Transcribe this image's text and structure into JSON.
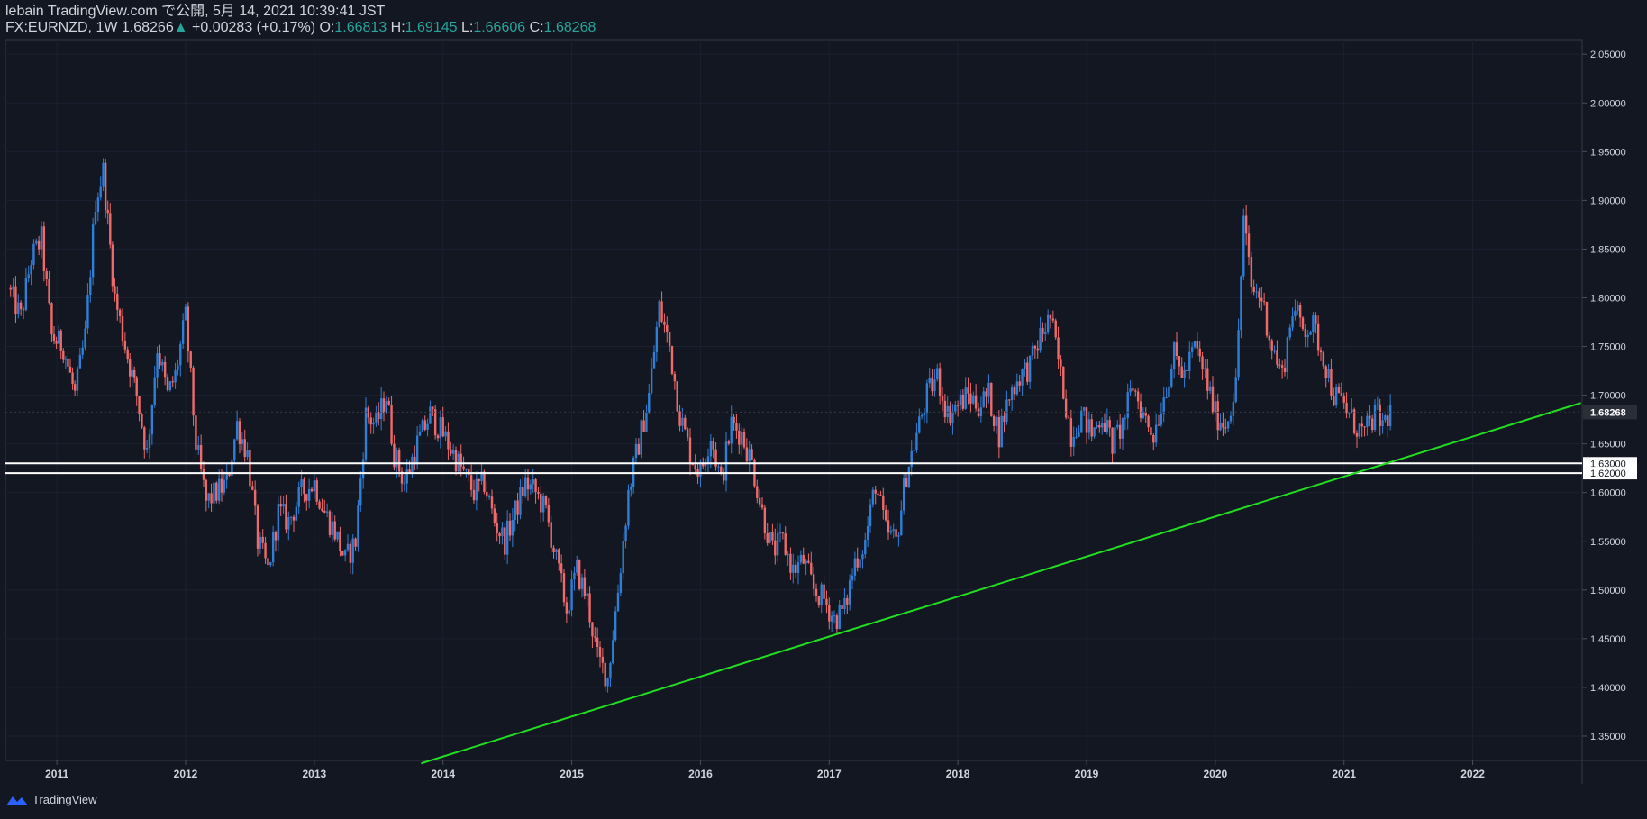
{
  "header": {
    "publish_line": "lebain TradingView.com で公開, 5月 14, 2021 10:39:41 JST",
    "symbol": "FX:EURNZD, 1W 1.68266",
    "change_arrow": "▲",
    "change": "+0.00283 (+0.17%)",
    "o_label": "O:",
    "o_value": "1.66813",
    "h_label": "H:",
    "h_value": "1.69145",
    "l_label": "L:",
    "l_value": "1.66606",
    "c_label": "C:",
    "c_value": "1.68268"
  },
  "footer": {
    "brand": "TradingView"
  },
  "colors": {
    "background": "#131722",
    "up_candle": "#2f7fd6",
    "down_candle": "#ef6b6b",
    "trendline": "#22dd22",
    "hline": "#ffffff",
    "price_label_bg": "#2a2e39"
  },
  "chart_data": {
    "type": "candlestick",
    "symbol": "FX:EURNZD",
    "interval": "1W",
    "x_ticks": [
      "2011",
      "2012",
      "2013",
      "2014",
      "2015",
      "2016",
      "2017",
      "2018",
      "2019",
      "2020",
      "2021",
      "2022"
    ],
    "y_ticks": [
      "1.35000",
      "1.40000",
      "1.45000",
      "1.50000",
      "1.55000",
      "1.60000",
      "1.65000",
      "1.70000",
      "1.75000",
      "1.80000",
      "1.85000",
      "1.90000",
      "1.95000",
      "2.00000",
      "2.05000"
    ],
    "ylim": [
      1.325,
      2.065
    ],
    "xlim": [
      2010.6,
      2022.85
    ],
    "last_price": "1.68268",
    "horizontal_levels": [
      {
        "label": "1.63000",
        "value": 1.63
      },
      {
        "label": "1.62000",
        "value": 1.62
      }
    ],
    "trendline": {
      "start": {
        "x": 2013.83,
        "y": 1.322
      },
      "end": {
        "x": 2022.84,
        "y": 1.692
      }
    },
    "close_path": [
      [
        2010.62,
        1.81
      ],
      [
        2010.72,
        1.78
      ],
      [
        2010.8,
        1.84
      ],
      [
        2010.88,
        1.86
      ],
      [
        2010.96,
        1.76
      ],
      [
        2011.05,
        1.75
      ],
      [
        2011.14,
        1.7
      ],
      [
        2011.22,
        1.76
      ],
      [
        2011.3,
        1.9
      ],
      [
        2011.36,
        1.93
      ],
      [
        2011.45,
        1.8
      ],
      [
        2011.55,
        1.74
      ],
      [
        2011.62,
        1.7
      ],
      [
        2011.7,
        1.64
      ],
      [
        2011.78,
        1.75
      ],
      [
        2011.86,
        1.7
      ],
      [
        2011.92,
        1.72
      ],
      [
        2012.0,
        1.78
      ],
      [
        2012.08,
        1.65
      ],
      [
        2012.16,
        1.59
      ],
      [
        2012.24,
        1.6
      ],
      [
        2012.32,
        1.61
      ],
      [
        2012.4,
        1.67
      ],
      [
        2012.48,
        1.64
      ],
      [
        2012.56,
        1.55
      ],
      [
        2012.64,
        1.52
      ],
      [
        2012.72,
        1.58
      ],
      [
        2012.8,
        1.57
      ],
      [
        2012.9,
        1.6
      ],
      [
        2013.0,
        1.61
      ],
      [
        2013.08,
        1.58
      ],
      [
        2013.16,
        1.56
      ],
      [
        2013.24,
        1.53
      ],
      [
        2013.32,
        1.55
      ],
      [
        2013.4,
        1.68
      ],
      [
        2013.48,
        1.67
      ],
      [
        2013.56,
        1.7
      ],
      [
        2013.62,
        1.64
      ],
      [
        2013.7,
        1.61
      ],
      [
        2013.8,
        1.65
      ],
      [
        2013.9,
        1.68
      ],
      [
        2014.0,
        1.66
      ],
      [
        2014.08,
        1.64
      ],
      [
        2014.16,
        1.62
      ],
      [
        2014.24,
        1.6
      ],
      [
        2014.32,
        1.61
      ],
      [
        2014.4,
        1.57
      ],
      [
        2014.48,
        1.55
      ],
      [
        2014.56,
        1.58
      ],
      [
        2014.64,
        1.61
      ],
      [
        2014.72,
        1.6
      ],
      [
        2014.8,
        1.58
      ],
      [
        2014.88,
        1.53
      ],
      [
        2014.96,
        1.48
      ],
      [
        2015.04,
        1.52
      ],
      [
        2015.12,
        1.49
      ],
      [
        2015.2,
        1.43
      ],
      [
        2015.28,
        1.41
      ],
      [
        2015.36,
        1.5
      ],
      [
        2015.44,
        1.6
      ],
      [
        2015.52,
        1.65
      ],
      [
        2015.6,
        1.7
      ],
      [
        2015.68,
        1.79
      ],
      [
        2015.76,
        1.75
      ],
      [
        2015.84,
        1.68
      ],
      [
        2015.92,
        1.64
      ],
      [
        2016.0,
        1.62
      ],
      [
        2016.08,
        1.66
      ],
      [
        2016.16,
        1.61
      ],
      [
        2016.24,
        1.67
      ],
      [
        2016.32,
        1.66
      ],
      [
        2016.4,
        1.63
      ],
      [
        2016.48,
        1.58
      ],
      [
        2016.56,
        1.54
      ],
      [
        2016.64,
        1.55
      ],
      [
        2016.72,
        1.52
      ],
      [
        2016.8,
        1.53
      ],
      [
        2016.88,
        1.5
      ],
      [
        2016.96,
        1.49
      ],
      [
        2017.04,
        1.47
      ],
      [
        2017.12,
        1.48
      ],
      [
        2017.2,
        1.53
      ],
      [
        2017.28,
        1.55
      ],
      [
        2017.36,
        1.61
      ],
      [
        2017.44,
        1.56
      ],
      [
        2017.52,
        1.55
      ],
      [
        2017.6,
        1.62
      ],
      [
        2017.68,
        1.66
      ],
      [
        2017.76,
        1.7
      ],
      [
        2017.84,
        1.72
      ],
      [
        2017.92,
        1.68
      ],
      [
        2018.0,
        1.69
      ],
      [
        2018.08,
        1.7
      ],
      [
        2018.16,
        1.69
      ],
      [
        2018.24,
        1.7
      ],
      [
        2018.32,
        1.66
      ],
      [
        2018.4,
        1.7
      ],
      [
        2018.48,
        1.72
      ],
      [
        2018.56,
        1.73
      ],
      [
        2018.64,
        1.76
      ],
      [
        2018.72,
        1.78
      ],
      [
        2018.8,
        1.72
      ],
      [
        2018.88,
        1.66
      ],
      [
        2018.96,
        1.68
      ],
      [
        2019.04,
        1.66
      ],
      [
        2019.12,
        1.68
      ],
      [
        2019.2,
        1.65
      ],
      [
        2019.28,
        1.67
      ],
      [
        2019.36,
        1.71
      ],
      [
        2019.44,
        1.68
      ],
      [
        2019.52,
        1.66
      ],
      [
        2019.6,
        1.7
      ],
      [
        2019.68,
        1.74
      ],
      [
        2019.76,
        1.72
      ],
      [
        2019.84,
        1.75
      ],
      [
        2019.92,
        1.72
      ],
      [
        2020.0,
        1.68
      ],
      [
        2020.08,
        1.67
      ],
      [
        2020.16,
        1.71
      ],
      [
        2020.22,
        1.88
      ],
      [
        2020.28,
        1.81
      ],
      [
        2020.36,
        1.8
      ],
      [
        2020.44,
        1.75
      ],
      [
        2020.52,
        1.72
      ],
      [
        2020.6,
        1.79
      ],
      [
        2020.68,
        1.77
      ],
      [
        2020.76,
        1.77
      ],
      [
        2020.84,
        1.74
      ],
      [
        2020.92,
        1.7
      ],
      [
        2021.0,
        1.69
      ],
      [
        2021.08,
        1.67
      ],
      [
        2021.16,
        1.66
      ],
      [
        2021.24,
        1.68
      ],
      [
        2021.3,
        1.67
      ],
      [
        2021.36,
        1.683
      ]
    ]
  }
}
